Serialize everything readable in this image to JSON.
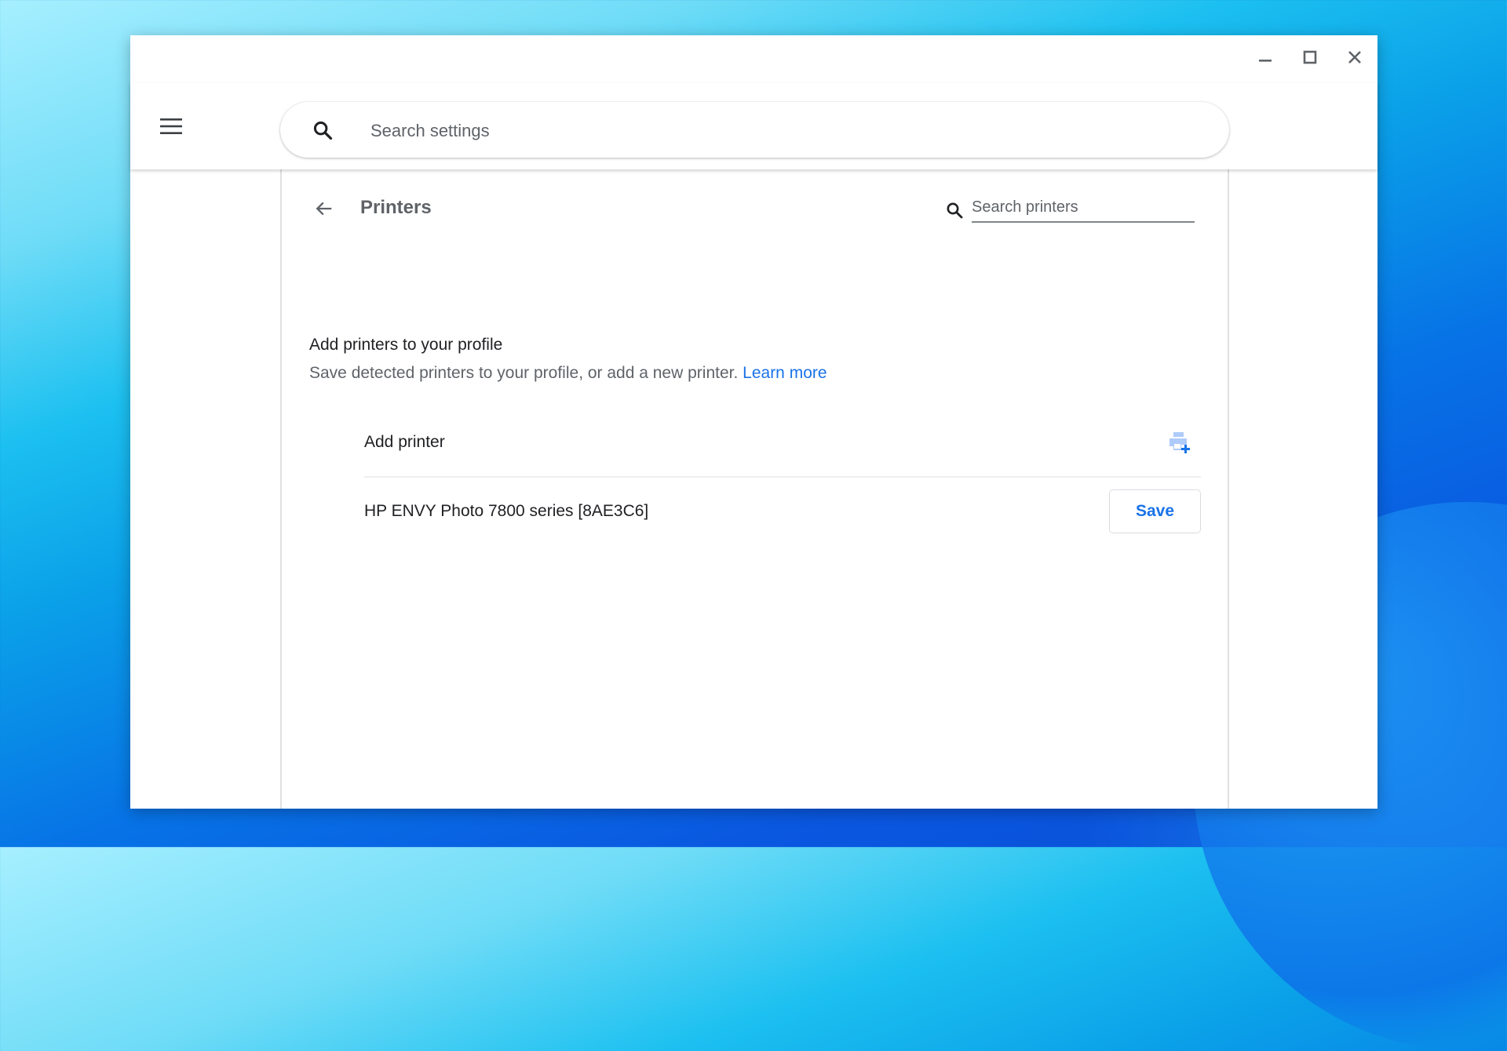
{
  "window": {
    "controls": {
      "minimize": "minimize-icon",
      "maximize": "maximize-icon",
      "close": "close-icon"
    }
  },
  "header": {
    "menu_icon": "hamburger-menu-icon",
    "search_icon": "search-icon",
    "search_placeholder": "Search settings",
    "search_value": ""
  },
  "subpage": {
    "back_icon": "arrow-back-icon",
    "title": "Printers",
    "search_icon": "search-icon",
    "search_placeholder": "Search printers",
    "search_value": ""
  },
  "section": {
    "title": "Add printers to your profile",
    "description": "Save detected printers to your profile, or add a new printer.",
    "learn_more_label": "Learn more"
  },
  "printers": {
    "add_row": {
      "label": "Add printer",
      "icon": "add-printer-icon"
    },
    "detected": [
      {
        "name": "HP ENVY Photo 7800 series [8AE3C6]",
        "action_label": "Save"
      }
    ]
  },
  "colors": {
    "accent": "#1a73e8",
    "icon_light": "#aecbfa"
  }
}
